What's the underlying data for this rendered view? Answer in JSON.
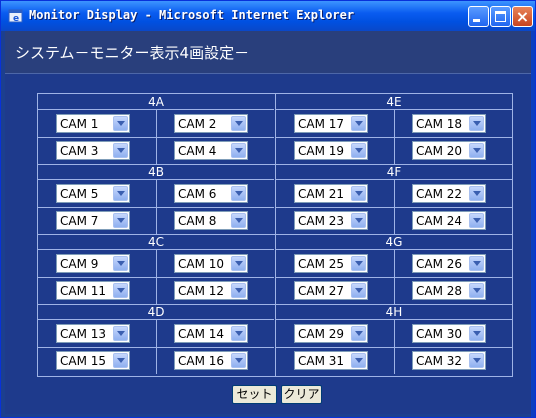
{
  "window": {
    "title": "Monitor Display - Microsoft Internet Explorer",
    "controls": [
      "minimize",
      "maximize",
      "close"
    ],
    "close_glyph": "×"
  },
  "page": {
    "title": "システム－モニター表示4画設定－"
  },
  "groups": [
    {
      "name": "4A",
      "cams": [
        "CAM 1",
        "CAM 2",
        "CAM 3",
        "CAM 4"
      ]
    },
    {
      "name": "4E",
      "cams": [
        "CAM 17",
        "CAM 18",
        "CAM 19",
        "CAM 20"
      ]
    },
    {
      "name": "4B",
      "cams": [
        "CAM 5",
        "CAM 6",
        "CAM 7",
        "CAM 8"
      ]
    },
    {
      "name": "4F",
      "cams": [
        "CAM 21",
        "CAM 22",
        "CAM 23",
        "CAM 24"
      ]
    },
    {
      "name": "4C",
      "cams": [
        "CAM 9",
        "CAM 10",
        "CAM 11",
        "CAM 12"
      ]
    },
    {
      "name": "4G",
      "cams": [
        "CAM 25",
        "CAM 26",
        "CAM 27",
        "CAM 28"
      ]
    },
    {
      "name": "4D",
      "cams": [
        "CAM 13",
        "CAM 14",
        "CAM 15",
        "CAM 16"
      ]
    },
    {
      "name": "4H",
      "cams": [
        "CAM 29",
        "CAM 30",
        "CAM 31",
        "CAM 32"
      ]
    }
  ],
  "buttons": {
    "set": "セット",
    "clear": "クリア"
  },
  "colors": {
    "accent": "#0a5cf0",
    "background": "#1e3a8c",
    "grid_line": "#9fb3e6"
  }
}
